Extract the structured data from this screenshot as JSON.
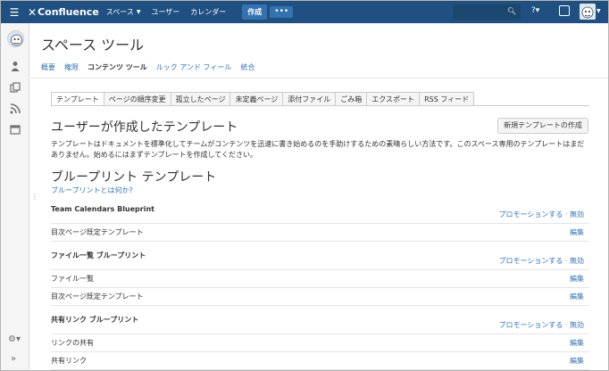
{
  "topbar": {
    "brand": "Confluence",
    "nav": [
      "スペース",
      "ユーザー",
      "カレンダー"
    ],
    "create_label": "作成",
    "more_label": "•••"
  },
  "page_title": "スペース ツール",
  "subnav": [
    "概要",
    "権限",
    "コンテンツ ツール",
    "ルック アンド フィール",
    "統合"
  ],
  "tabs": [
    "テンプレート",
    "ページの順序変更",
    "孤立したページ",
    "未定義ページ",
    "添付ファイル",
    "ごみ箱",
    "エクスポート",
    "RSS フィード"
  ],
  "user_templates": {
    "heading": "ユーザーが作成したテンプレート",
    "new_button": "新規テンプレートの作成",
    "description": "テンプレートはドキュメントを標準化してチームがコンテンツを迅速に書き始めるのを手助けするための素晴らしい方法です。このスペース専用のテンプレートはまだありません。始めるにはまずテンプレートを作成してください。"
  },
  "blueprint": {
    "heading": "ブループリント テンプレート",
    "what_link": "ブループリントとは何か?",
    "promote": "プロモーションする",
    "separator": "·",
    "disable": "無効",
    "edit": "編集",
    "groups": [
      {
        "name": "Team Calendars Blueprint",
        "items": [
          "目次ページ既定テンプレート"
        ]
      },
      {
        "name": "ファイル一覧 ブループリント",
        "items": [
          "ファイル一覧",
          "目次ページ既定テンプレート"
        ]
      },
      {
        "name": "共有リンク ブループリント",
        "items": [
          "リンクの共有",
          "共有リンク"
        ]
      }
    ]
  }
}
